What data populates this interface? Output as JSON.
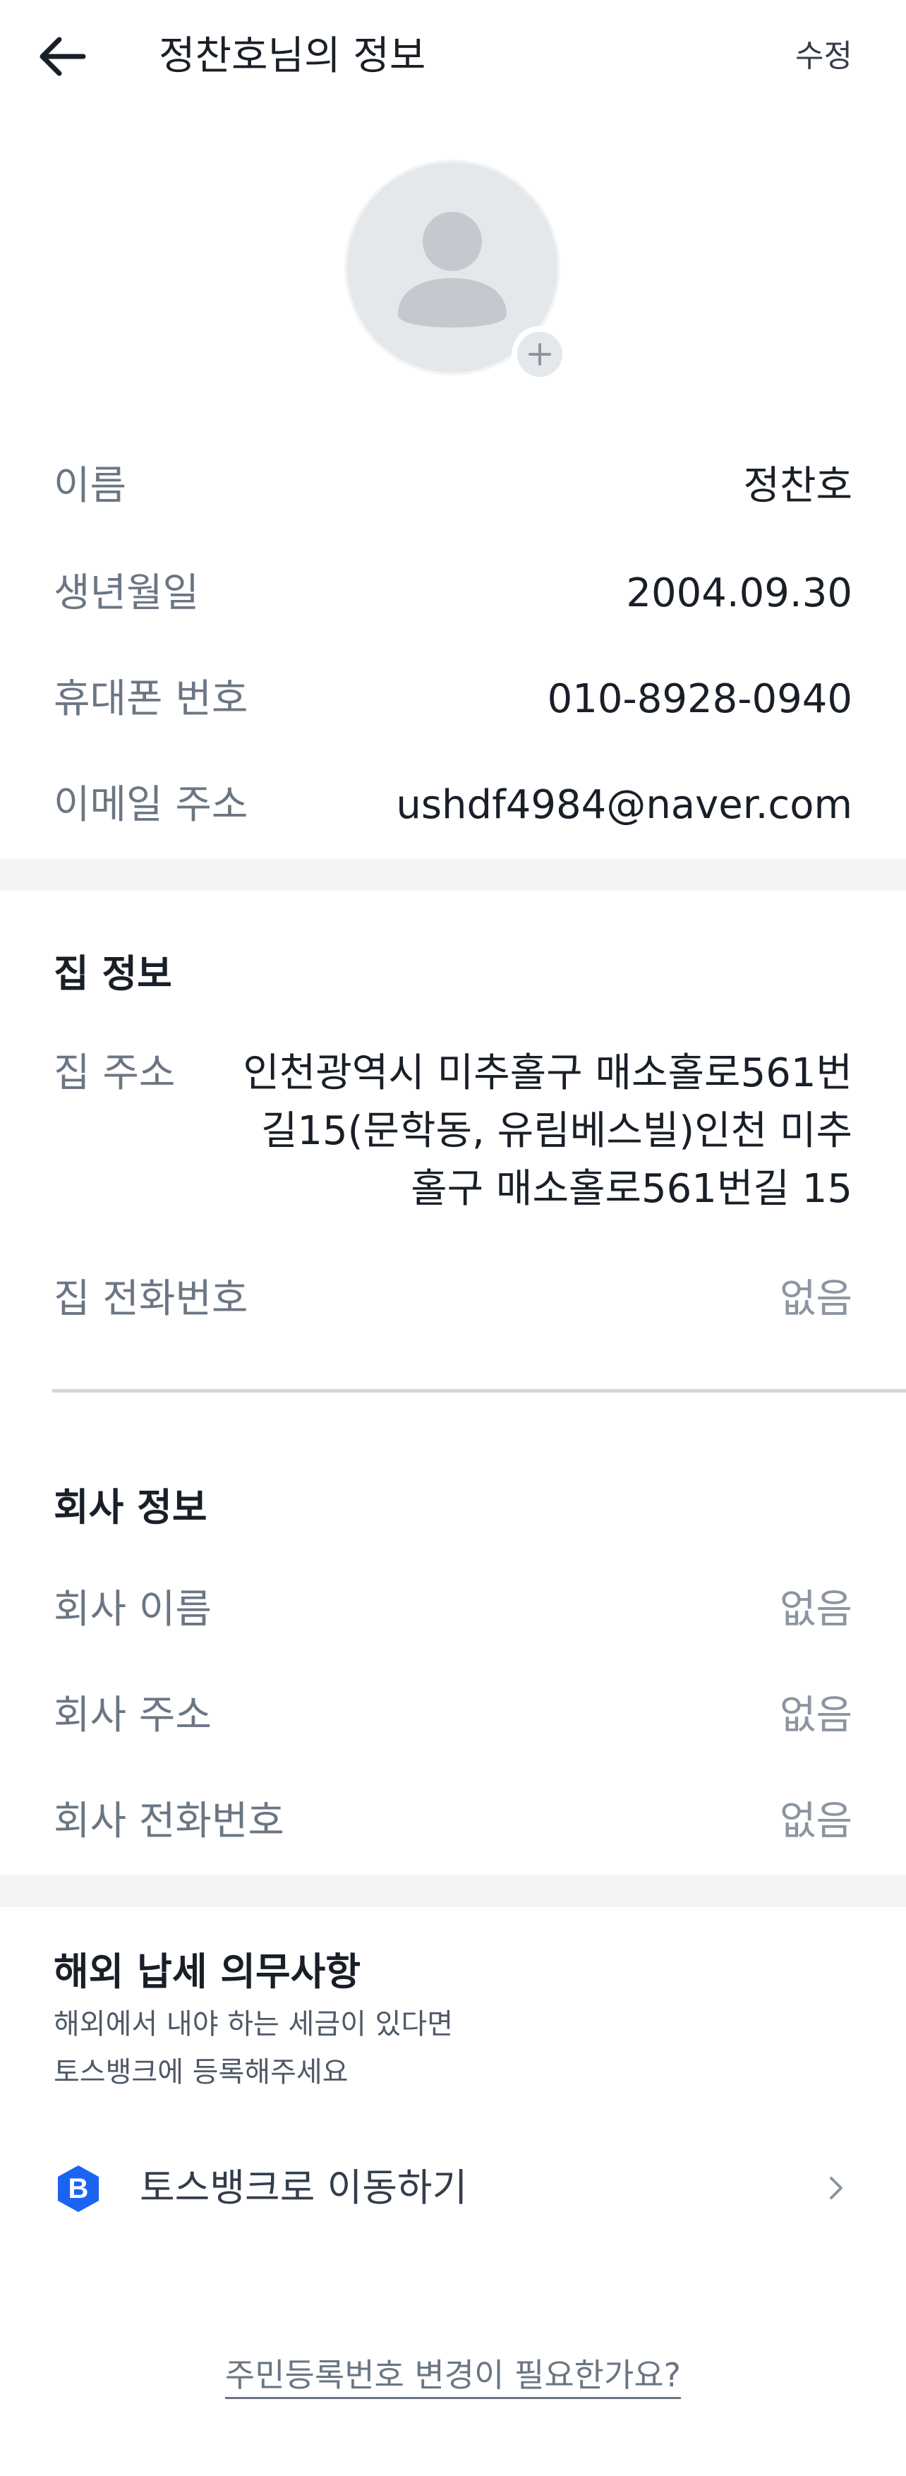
{
  "header": {
    "title": "정찬호님의 정보",
    "edit_label": "수정"
  },
  "icons": {
    "back": "back-arrow-icon",
    "avatar": "person-placeholder-icon",
    "add": "plus-icon",
    "bank": "toss-bank-b-icon",
    "chevron": "chevron-right-icon"
  },
  "colors": {
    "bank_blue": "#1b64f2"
  },
  "basic": {
    "name_label": "이름",
    "name_value": "정찬호",
    "birth_label": "생년월일",
    "birth_value": "2004.09.30",
    "phone_label": "휴대폰 번호",
    "phone_value": "010-8928-0940",
    "email_label": "이메일 주소",
    "email_value": "ushdf4984@naver.com"
  },
  "home": {
    "title": "집 정보",
    "address_label": "집 주소",
    "address_lines": [
      "인천광역시 미추홀구 매소홀로561번",
      "길15(문학동, 유림베스빌)인천 미추",
      "홀구 매소홀로561번길 15"
    ],
    "phone_label": "집 전화번호",
    "phone_value": "없음"
  },
  "company": {
    "title": "회사 정보",
    "name_label": "회사 이름",
    "name_value": "없음",
    "address_label": "회사 주소",
    "address_value": "없음",
    "phone_label": "회사 전화번호",
    "phone_value": "없음"
  },
  "tax": {
    "title": "해외 납세 의무사항",
    "subtitle_line1": "해외에서 내야 하는 세금이 있다면",
    "subtitle_line2": "토스뱅크에 등록해주세요",
    "bank_icon_letter": "B",
    "bank_label": "토스뱅크로 이동하기"
  },
  "footer": {
    "rrn_link": "주민등록번호 변경이 필요한가요?"
  }
}
